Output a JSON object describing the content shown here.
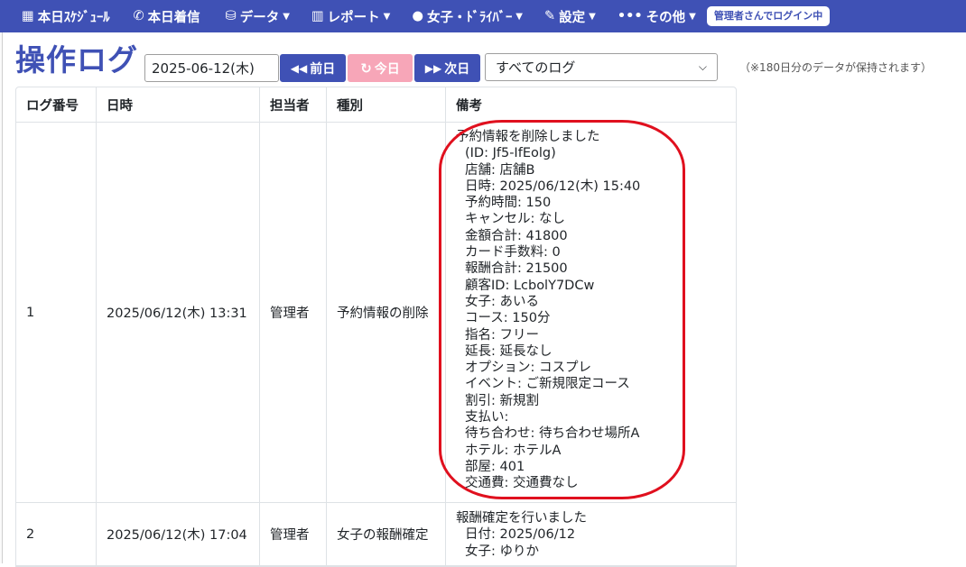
{
  "nav": {
    "items": [
      {
        "label": "本日ｽｹｼﾞｭｰﾙ",
        "icon": "calendar-icon",
        "glyph": "▦",
        "dropdown": false
      },
      {
        "label": "本日着信",
        "icon": "phone-icon",
        "glyph": "✆",
        "dropdown": false
      },
      {
        "label": "データ",
        "icon": "database-icon",
        "glyph": "⛁",
        "dropdown": true
      },
      {
        "label": "レポート",
        "icon": "bar-chart-icon",
        "glyph": "▥",
        "dropdown": true
      },
      {
        "label": "女子・ﾄﾞﾗｲﾊﾞｰ",
        "icon": "user-icon",
        "glyph": "●",
        "dropdown": true
      },
      {
        "label": "設定",
        "icon": "wrench-icon",
        "glyph": "✎",
        "dropdown": true
      },
      {
        "label": "その他",
        "icon": "more-icon",
        "glyph": "•••",
        "dropdown": true
      }
    ],
    "login_status": "管理者さんでログイン中"
  },
  "page": {
    "title": "操作ログ",
    "date_value": "2025-06-12(木)",
    "prev_label": "前日",
    "today_label": "今日",
    "next_label": "次日",
    "filter_selected": "すべてのログ",
    "retention_note": "（※180日分のデータが保持されます）"
  },
  "table": {
    "headers": [
      "ログ番号",
      "日時",
      "担当者",
      "種別",
      "備考"
    ],
    "rows": [
      {
        "no": "1",
        "datetime": "2025/06/12(木) 13:31",
        "user": "管理者",
        "type": "予約情報の削除",
        "note_lines": [
          "予約情報を削除しました",
          "(ID: Jf5-IfEolg)",
          "店舗: 店舗B",
          "日時: 2025/06/12(木) 15:40",
          "予約時間: 150",
          "キャンセル: なし",
          "金額合計: 41800",
          "カード手数料: 0",
          "報酬合計: 21500",
          "顧客ID: LcbolY7DCw",
          "女子: あいる",
          "コース: 150分",
          "指名: フリー",
          "延長: 延長なし",
          "オプション: コスプレ",
          "イベント: ご新規限定コース",
          "割引: 新規割",
          "支払い:",
          "待ち合わせ: 待ち合わせ場所A",
          "ホテル: ホテルA",
          "部屋: 401",
          "交通費: 交通費なし"
        ],
        "highlighted": true
      },
      {
        "no": "2",
        "datetime": "2025/06/12(木) 17:04",
        "user": "管理者",
        "type": "女子の報酬確定",
        "note_lines": [
          "報酬確定を行いました",
          "日付: 2025/06/12",
          "女子: ゆりか"
        ],
        "highlighted": false
      }
    ]
  },
  "colors": {
    "primary": "#3f51b5",
    "today_button": "#f7a6b8",
    "highlight_ring": "#e0101e"
  }
}
